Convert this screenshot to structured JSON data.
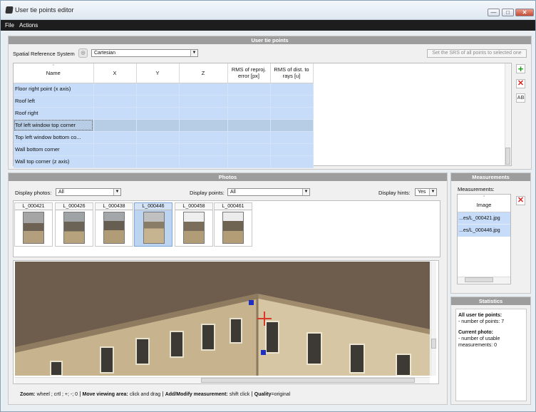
{
  "window": {
    "title": "User tie points editor",
    "minimize": "—",
    "maximize": "□",
    "close": "✕"
  },
  "menu": {
    "file": "File",
    "actions": "Actions"
  },
  "tiepoints": {
    "header": "User tie points",
    "srs_label": "Spatial Reference System",
    "srs_value": "Cartesian",
    "set_srs_button": "Set the SRS of all points to selected one",
    "columns": [
      "Name",
      "X",
      "Y",
      "Z",
      "RMS of reproj. error [px]",
      "RMS of dist. to rays [u]"
    ],
    "rows": [
      "Floor right point (x axis)",
      "Roof left",
      "Roof right",
      "Tof left window top corner",
      "Top left window bottom co...",
      "Wall bottom corner",
      "Wall top corner (z axis)"
    ]
  },
  "photos": {
    "header": "Photos",
    "display_photos_label": "Display photos:",
    "display_photos_value": "All",
    "display_points_label": "Display points:",
    "display_points_value": "All",
    "display_hints_label": "Display hints:",
    "display_hints_value": "Yes",
    "thumbnails": [
      "L_000421",
      "L_000426",
      "L_000438",
      "L_000446",
      "L_000458",
      "L_000461"
    ],
    "selected_thumbnail": "L_000446"
  },
  "measurements": {
    "header": "Measurements",
    "label": "Measurements:",
    "column": "Image",
    "items": [
      "...es/L_000421.jpg",
      "...es/L_000446.jpg"
    ]
  },
  "statistics": {
    "header": "Statistics",
    "all_title": "All user tie points:",
    "all_detail": "- number of points: 7",
    "current_title": "Current photo:",
    "current_detail1": "- number of usable",
    "current_detail2": "measurements: 0"
  },
  "statusbar": {
    "zoom_key": "Zoom:",
    "zoom_val": "wheel ; crtl ; +; -; 0",
    "move_key": "Move viewing area:",
    "move_val": "click and drag",
    "add_key": "Add/Modify measurement:",
    "add_val": "shift click",
    "quality_key": "Quality",
    "quality_val": "=original"
  },
  "colors": {
    "selection": "#c6dcf8",
    "panel_header": "#9d9d9d",
    "menubar": "#1d1d1d"
  }
}
